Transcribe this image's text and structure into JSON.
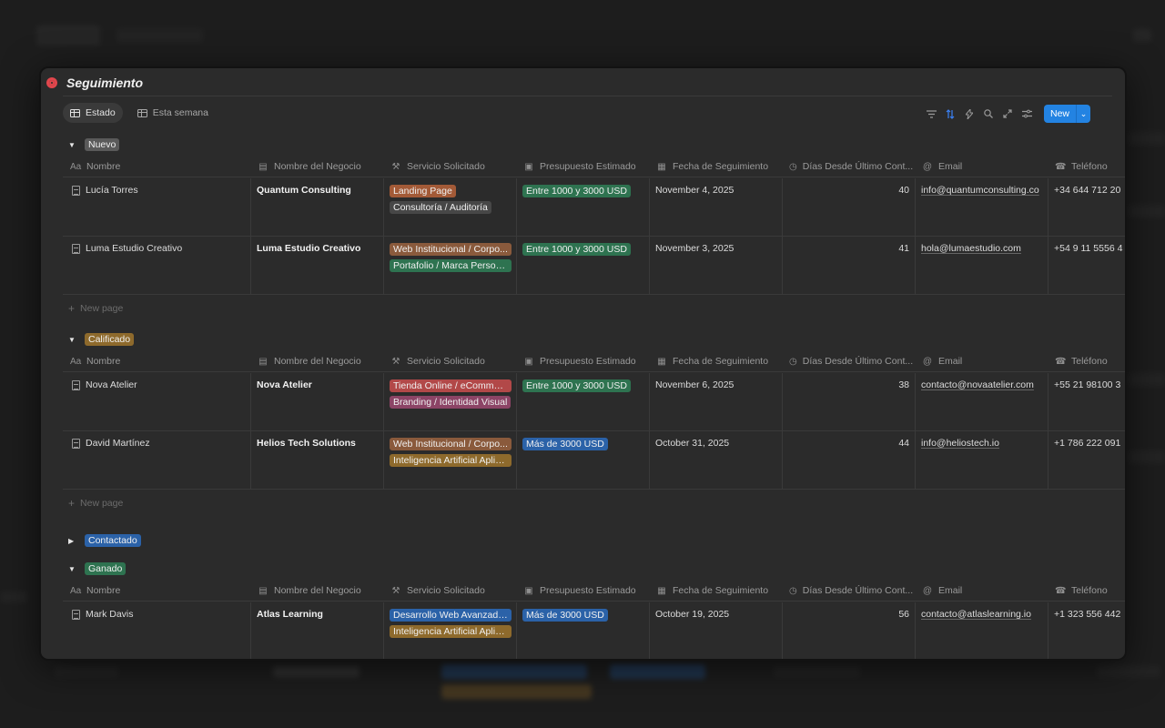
{
  "colors": {
    "accent": "#2383e2",
    "tag_orange": "#a35a37",
    "tag_gray": "#474747",
    "tag_green": "#2e7350",
    "tag_red": "#b24848",
    "tag_pink": "#8c4466",
    "tag_brown": "#8a5a3c",
    "tag_yellow": "#8e6a2c",
    "tag_blue": "#2b62a8"
  },
  "page": {
    "title": "Seguimiento",
    "title_icon": "target-icon"
  },
  "tabs": [
    {
      "label": "Estado",
      "icon": "table-icon"
    },
    {
      "label": "Esta semana",
      "icon": "table-icon"
    }
  ],
  "toolbar": {
    "icons": [
      "filter-icon",
      "sort-icon",
      "lightning-icon",
      "search-icon",
      "expand-icon",
      "settings-icon"
    ],
    "new_label": "New"
  },
  "columns": [
    {
      "label": "Nombre",
      "icon": "text-icon"
    },
    {
      "label": "Nombre del Negocio",
      "icon": "briefcase-icon"
    },
    {
      "label": "Servicio Solicitado",
      "icon": "wrench-icon"
    },
    {
      "label": "Presupuesto Estimado",
      "icon": "money-icon"
    },
    {
      "label": "Fecha de Seguimiento",
      "icon": "calendar-icon"
    },
    {
      "label": "Días Desde Último Cont...",
      "icon": "clock-icon"
    },
    {
      "label": "Email",
      "icon": "at-icon"
    },
    {
      "label": "Teléfono",
      "icon": "phone-icon"
    }
  ],
  "new_page_label": "New page",
  "groups": [
    {
      "status": "Nuevo",
      "expanded": true,
      "rows": [
        {
          "nombre": "Lucía Torres",
          "negocio": "Quantum Consulting",
          "servicios": [
            {
              "label": "Landing Page",
              "color": "#a35a37"
            },
            {
              "label": "Consultoría / Auditoría",
              "color": "#474747"
            }
          ],
          "presupuesto": {
            "label": "Entre 1000 y 3000 USD",
            "color": "#2e7350"
          },
          "fecha": "November 4, 2025",
          "dias": "40",
          "email": "info@quantumconsulting.co",
          "telefono": "+34 644 712 20"
        },
        {
          "nombre": "Luma Estudio Creativo",
          "negocio": "Luma Estudio Creativo",
          "servicios": [
            {
              "label": "Web Institucional / Corpo...",
              "color": "#8a5a3c"
            },
            {
              "label": "Portafolio / Marca Personal",
              "color": "#2e7350"
            }
          ],
          "presupuesto": {
            "label": "Entre 1000 y 3000 USD",
            "color": "#2e7350"
          },
          "fecha": "November 3, 2025",
          "dias": "41",
          "email": "hola@lumaestudio.com",
          "telefono": "+54 9 11 5556 4"
        }
      ]
    },
    {
      "status": "Calificado",
      "expanded": true,
      "rows": [
        {
          "nombre": "Nova Atelier",
          "negocio": "Nova Atelier",
          "servicios": [
            {
              "label": "Tienda Online / eCommer...",
              "color": "#b24848"
            },
            {
              "label": "Branding / Identidad Visual",
              "color": "#8c4466"
            }
          ],
          "presupuesto": {
            "label": "Entre 1000 y 3000 USD",
            "color": "#2e7350"
          },
          "fecha": "November 6, 2025",
          "dias": "38",
          "email": "contacto@novaatelier.com",
          "telefono": "+55 21 98100 3"
        },
        {
          "nombre": "David Martínez",
          "negocio": "Helios Tech Solutions",
          "servicios": [
            {
              "label": "Web Institucional / Corpo...",
              "color": "#8a5a3c"
            },
            {
              "label": "Inteligencia Artificial Aplic...",
              "color": "#8e6a2c"
            }
          ],
          "presupuesto": {
            "label": "Más de 3000 USD",
            "color": "#2b62a8"
          },
          "fecha": "October 31, 2025",
          "dias": "44",
          "email": "info@heliostech.io",
          "telefono": "+1 786 222 091"
        }
      ]
    },
    {
      "status": "Contactado",
      "expanded": false,
      "rows": []
    },
    {
      "status": "Ganado",
      "expanded": true,
      "rows": [
        {
          "nombre": "Mark Davis",
          "negocio": "Atlas Learning",
          "servicios": [
            {
              "label": "Desarrollo Web Avanzado...",
              "color": "#2b62a8"
            },
            {
              "label": "Inteligencia Artificial Aplic...",
              "color": "#8e6a2c"
            }
          ],
          "presupuesto": {
            "label": "Más de 3000 USD",
            "color": "#2b62a8"
          },
          "fecha": "October 19, 2025",
          "dias": "56",
          "email": "contacto@atlaslearning.io",
          "telefono": "+1 323 556 442"
        }
      ]
    }
  ],
  "status_colors": {
    "Nuevo": "#5a5a5a",
    "Calificado": "#8e6a2c",
    "Contactado": "#2b62a8",
    "Ganado": "#2e7350"
  }
}
